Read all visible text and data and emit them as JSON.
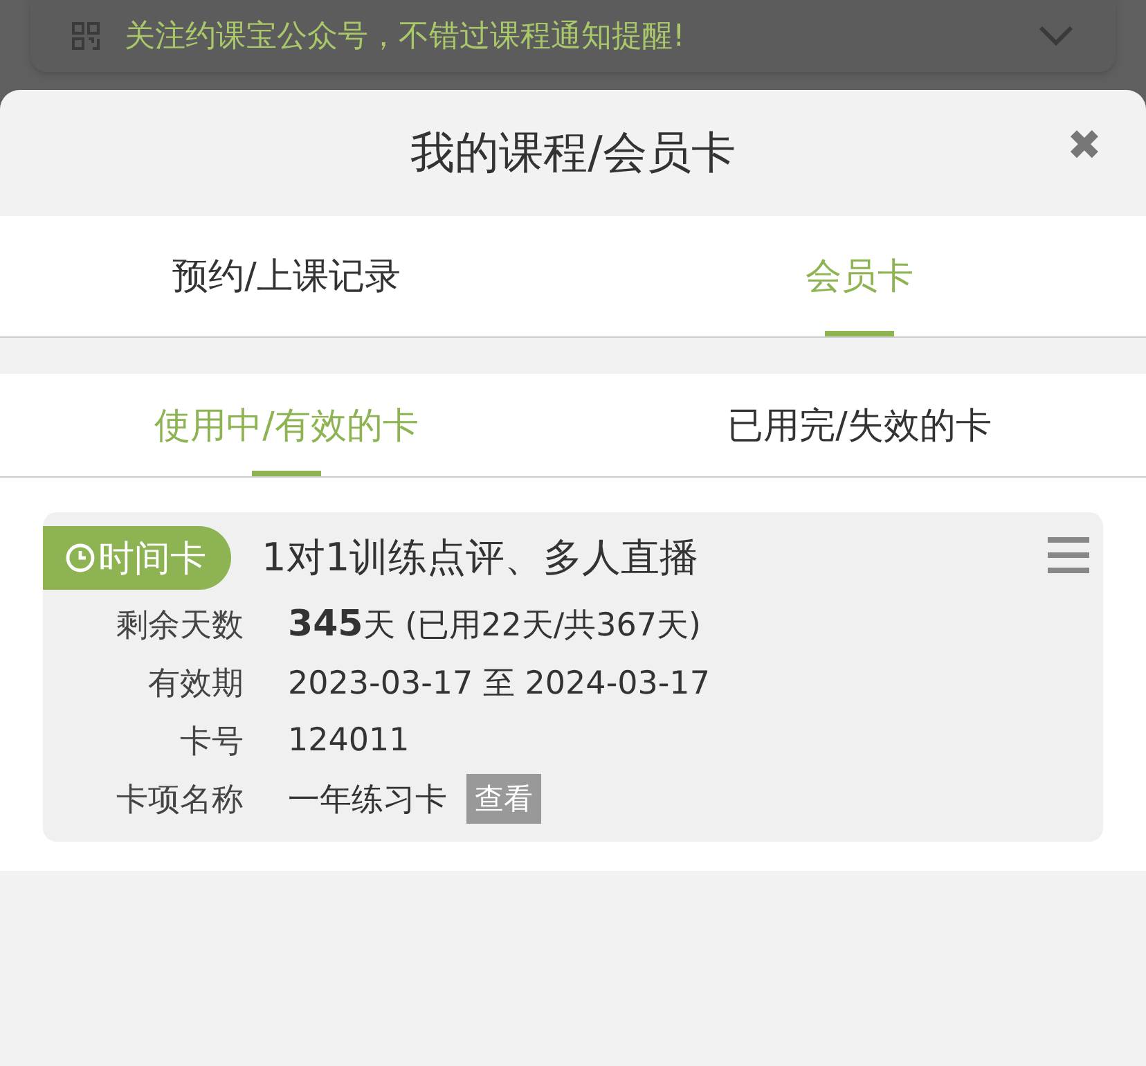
{
  "banner": {
    "text": "关注约课宝公众号，不错过课程通知提醒!"
  },
  "sheet": {
    "title": "我的课程/会员卡",
    "close": "✖"
  },
  "tabs": [
    {
      "label": "预约/上课记录",
      "selected": false
    },
    {
      "label": "会员卡",
      "selected": true
    }
  ],
  "subtabs": [
    {
      "label": "使用中/有效的卡",
      "selected": true
    },
    {
      "label": "已用完/失效的卡",
      "selected": false
    }
  ],
  "cards": [
    {
      "type_badge": "时间卡",
      "title": "1对1训练点评、多人直播",
      "fields": [
        {
          "label": "剩余天数",
          "value": "**345**天 (已用22天/共367天)"
        },
        {
          "label": "有效期",
          "value": "2023-03-17 至 2024-03-17"
        },
        {
          "label": "卡号",
          "value": "124011"
        },
        {
          "label": "卡项名称",
          "value": "一年练习卡",
          "button": "查看"
        }
      ]
    }
  ]
}
